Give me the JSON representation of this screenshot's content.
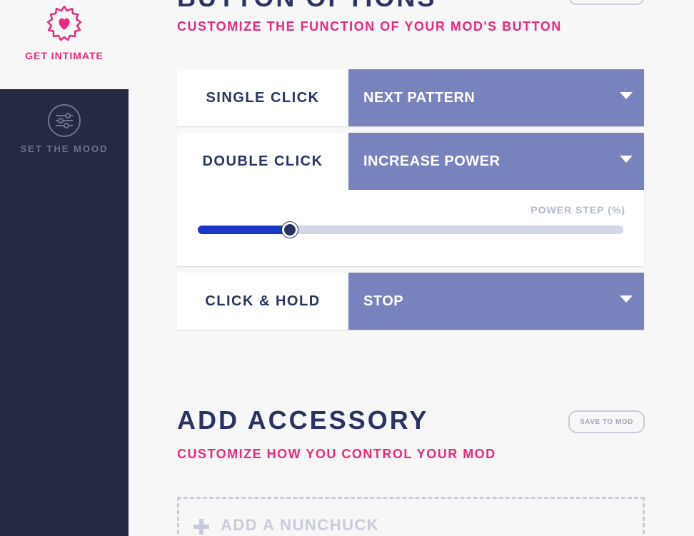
{
  "sidebar": {
    "items": [
      {
        "label": "GET INTIMATE",
        "icon": "heart-badge-icon",
        "active": true
      },
      {
        "label": "SET THE MOOD",
        "icon": "sliders-icon",
        "active": false
      }
    ]
  },
  "colors": {
    "accent_pink": "#e8297e",
    "navy": "#2b3362",
    "sidebar_bg": "#252a42",
    "select_bg": "#7882bd",
    "slider_fill": "#1a36c7"
  },
  "button_options": {
    "title": "BUTTON OPTIONS",
    "subtitle": "CUSTOMIZE THE FUNCTION OF YOUR MOD'S BUTTON",
    "rows": [
      {
        "label": "SINGLE CLICK",
        "value": "NEXT PATTERN"
      },
      {
        "label": "DOUBLE CLICK",
        "value": "INCREASE POWER",
        "slider": {
          "label": "POWER STEP (%)",
          "value_fraction": 0.21
        }
      },
      {
        "label": "CLICK & HOLD",
        "value": "STOP"
      }
    ]
  },
  "add_accessory": {
    "title": "ADD ACCESSORY",
    "subtitle": "CUSTOMIZE HOW YOU CONTROL YOUR MOD",
    "save_label": "SAVE TO MOD",
    "add_label": "ADD A NUNCHUCK"
  }
}
